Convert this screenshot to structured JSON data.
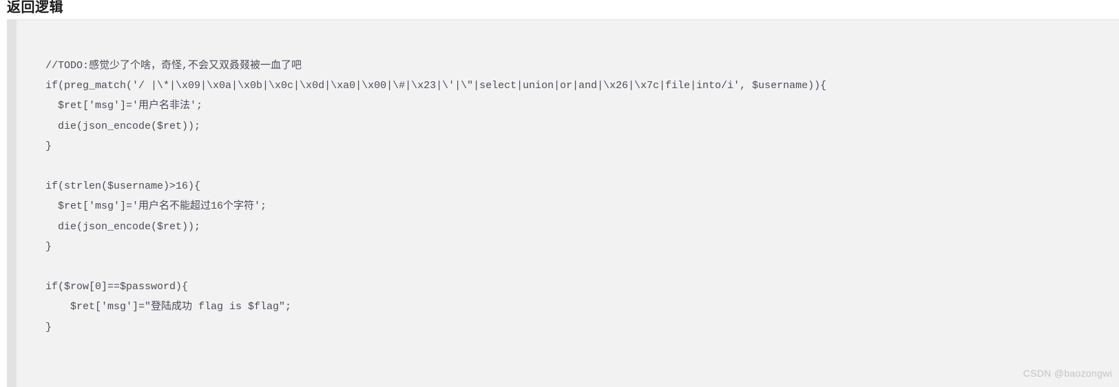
{
  "section": {
    "title": "返回逻辑"
  },
  "code_block": {
    "language": "php",
    "background_color": "#f2f2f2",
    "gutter_color": "#e2e2e2",
    "text_color": "#4c4c5c",
    "lines": [
      "//TODO:感觉少了个啥，奇怪,不会又双叒叕被一血了吧",
      "if(preg_match('/ |\\*|\\x09|\\x0a|\\x0b|\\x0c|\\x0d|\\xa0|\\x00|\\#|\\x23|\\'|\\\"|select|union|or|and|\\x26|\\x7c|file|into/i', $username)){",
      "  $ret['msg']='用户名非法';",
      "  die(json_encode($ret));",
      "}",
      "",
      "if(strlen($username)>16){",
      "  $ret['msg']='用户名不能超过16个字符';",
      "  die(json_encode($ret));",
      "}",
      "",
      "if($row[0]==$password){",
      "    $ret['msg']=\"登陆成功 flag is $flag\";",
      "}"
    ]
  },
  "watermark": {
    "text": "CSDN @baozongwi"
  }
}
